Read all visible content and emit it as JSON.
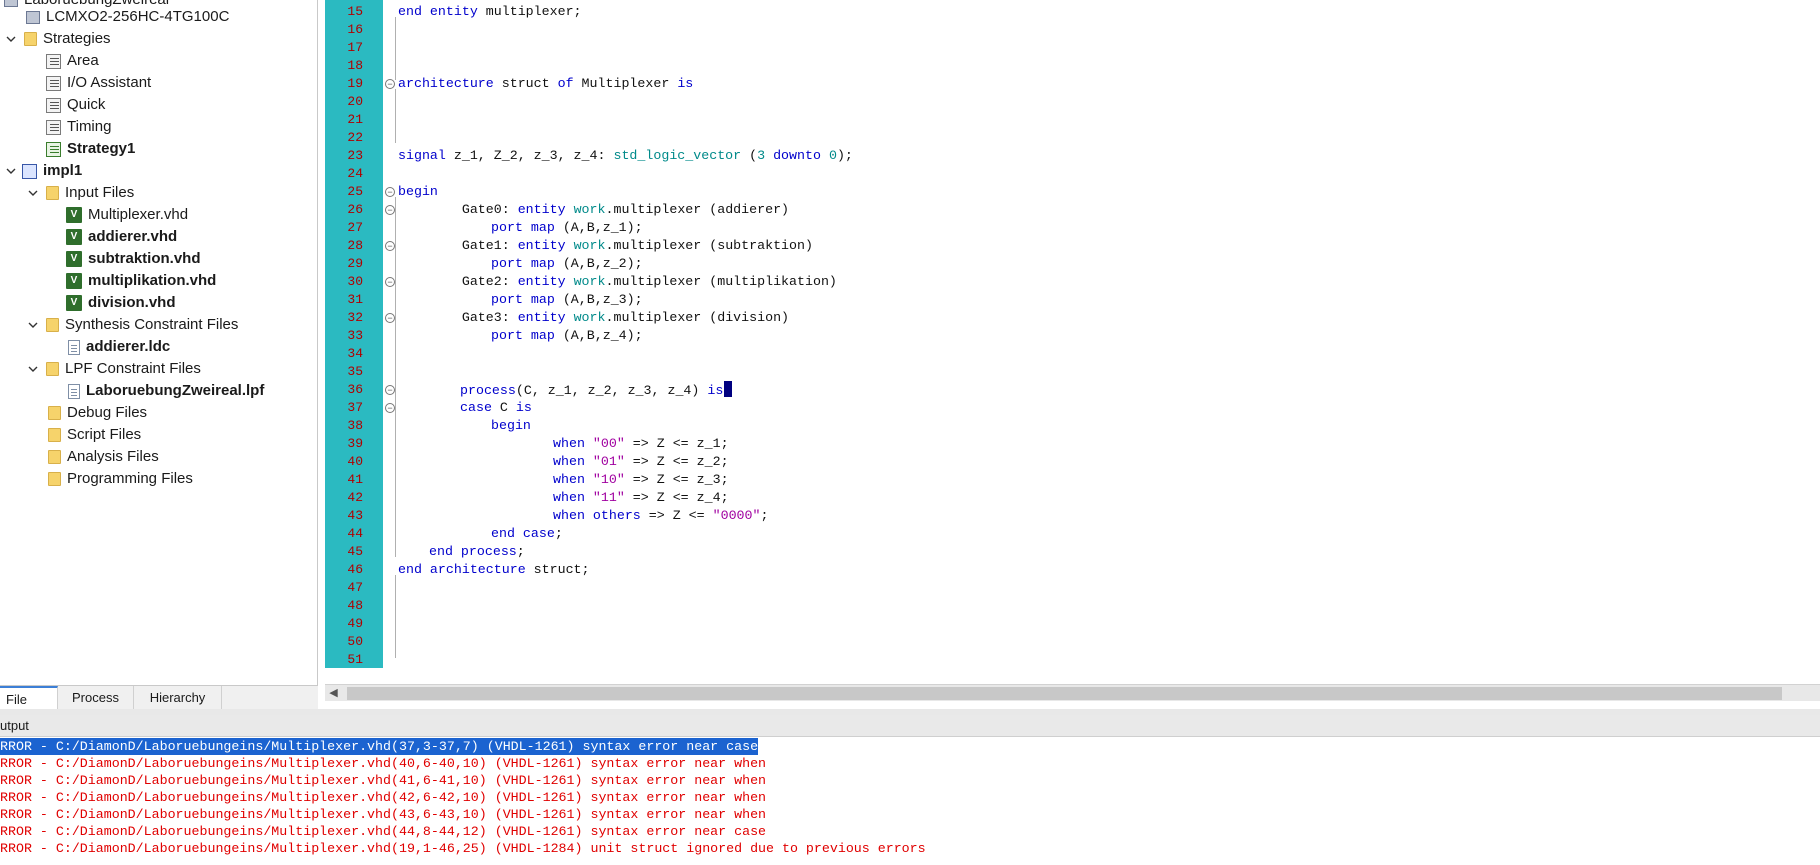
{
  "tree": {
    "top_item": "LaboruebungZweireal",
    "device": "LCMXO2-256HC-4TG100C",
    "strategies_label": "Strategies",
    "strategies": [
      "Area",
      "I/O Assistant",
      "Quick",
      "Timing",
      "Strategy1"
    ],
    "impl_label": "impl1",
    "input_files_label": "Input Files",
    "input_files": [
      "Multiplexer.vhd",
      "addierer.vhd",
      "subtraktion.vhd",
      "multiplikation.vhd",
      "division.vhd"
    ],
    "synthesis_label": "Synthesis Constraint Files",
    "synthesis_files": [
      "addierer.ldc"
    ],
    "lpf_label": "LPF Constraint Files",
    "lpf_files": [
      "LaboruebungZweireal.lpf"
    ],
    "other_folders": [
      "Debug Files",
      "Script Files",
      "Analysis Files",
      "Programming Files"
    ]
  },
  "tree_tabs": [
    "File List",
    "Process",
    "Hierarchy"
  ],
  "editor": {
    "line_numbers": [
      "15",
      "16",
      "17",
      "18",
      "19",
      "20",
      "21",
      "22",
      "23",
      "24",
      "25",
      "26",
      "27",
      "28",
      "29",
      "30",
      "31",
      "32",
      "33",
      "34",
      "35",
      "36",
      "37",
      "38",
      "39",
      "40",
      "41",
      "42",
      "43",
      "44",
      "45",
      "46",
      "47",
      "48",
      "49",
      "50",
      "51"
    ],
    "code": {
      "l15_kw": "end entity",
      "l15_rest": " multiplexer;",
      "l19_kw1": "architecture",
      "l19_mid": " struct ",
      "l19_kw2": "of",
      "l19_name": " Multiplexer ",
      "l19_kw3": "is",
      "l23_kw": "signal",
      "l23_rest": " z_1, Z_2, z_3, z_4: ",
      "l23_type": "std_logic_vector",
      "l23_p1": " (",
      "l23_n1": "3",
      "l23_sp": " ",
      "l23_kw2": "downto",
      "l23_sp2": " ",
      "l23_n2": "0",
      "l23_end": ");",
      "l25_kw": "begin",
      "gate_rows": [
        {
          "label": "        Gate0: ",
          "kw": "entity",
          "lib": " work",
          "rest": ".multiplexer (addierer)",
          "map_kw": "port map",
          "map_rest": " (A,B,z_1);"
        },
        {
          "label": "        Gate1: ",
          "kw": "entity",
          "lib": " work",
          "rest": ".multiplexer (subtraktion)",
          "map_kw": "port map",
          "map_rest": " (A,B,z_2);"
        },
        {
          "label": "        Gate2: ",
          "kw": "entity",
          "lib": " work",
          "rest": ".multiplexer (multiplikation)",
          "map_kw": "port map",
          "map_rest": " (A,B,z_3);"
        },
        {
          "label": "        Gate3: ",
          "kw": "entity",
          "lib": " work",
          "rest": ".multiplexer (division)",
          "map_kw": "port map",
          "map_rest": " (A,B,z_4);"
        }
      ],
      "l36_kw": "process",
      "l36_rest": "(C, z_1, z_2, z_3, z_4) ",
      "l36_kw2": "is",
      "l37_kw": "case",
      "l37_rest": " C ",
      "l37_kw2": "is",
      "l38_kw": "begin",
      "when_rows": [
        {
          "val": "\"00\"",
          "rest": " => Z <= z_1;"
        },
        {
          "val": "\"01\"",
          "rest": " => Z <= z_2;"
        },
        {
          "val": "\"10\"",
          "rest": " => Z <= z_3;"
        },
        {
          "val": "\"11\"",
          "rest": " => Z <= z_4;"
        }
      ],
      "when_kw": "when",
      "l43_kw": "when others",
      "l43_rest": " => Z <= ",
      "l43_val": "\"0000\"",
      "l43_end": ";",
      "l44_kw": "end case",
      "l44_end": ";",
      "l45_kw": "end process",
      "l45_end": ";",
      "l46_kw": "end architecture",
      "l46_rest": " struct;"
    }
  },
  "output": {
    "title": "utput",
    "lines": [
      "RROR - C:/DiamonD/Laboruebungeins/Multiplexer.vhd(37,3-37,7) (VHDL-1261) syntax error near case",
      "RROR - C:/DiamonD/Laboruebungeins/Multiplexer.vhd(40,6-40,10) (VHDL-1261) syntax error near when",
      "RROR - C:/DiamonD/Laboruebungeins/Multiplexer.vhd(41,6-41,10) (VHDL-1261) syntax error near when",
      "RROR - C:/DiamonD/Laboruebungeins/Multiplexer.vhd(42,6-42,10) (VHDL-1261) syntax error near when",
      "RROR - C:/DiamonD/Laboruebungeins/Multiplexer.vhd(43,6-43,10) (VHDL-1261) syntax error near when",
      "RROR - C:/DiamonD/Laboruebungeins/Multiplexer.vhd(44,8-44,12) (VHDL-1261) syntax error near case",
      "RROR - C:/DiamonD/Laboruebungeins/Multiplexer.vhd(19,1-46,25) (VHDL-1284) unit struct ignored due to previous errors"
    ]
  },
  "colors": {
    "gutter": "#2bbac1",
    "keyword": "#0000cc",
    "type": "#008a8a",
    "string": "#a000a0",
    "error": "#e00000",
    "selection": "#1b63d0"
  }
}
